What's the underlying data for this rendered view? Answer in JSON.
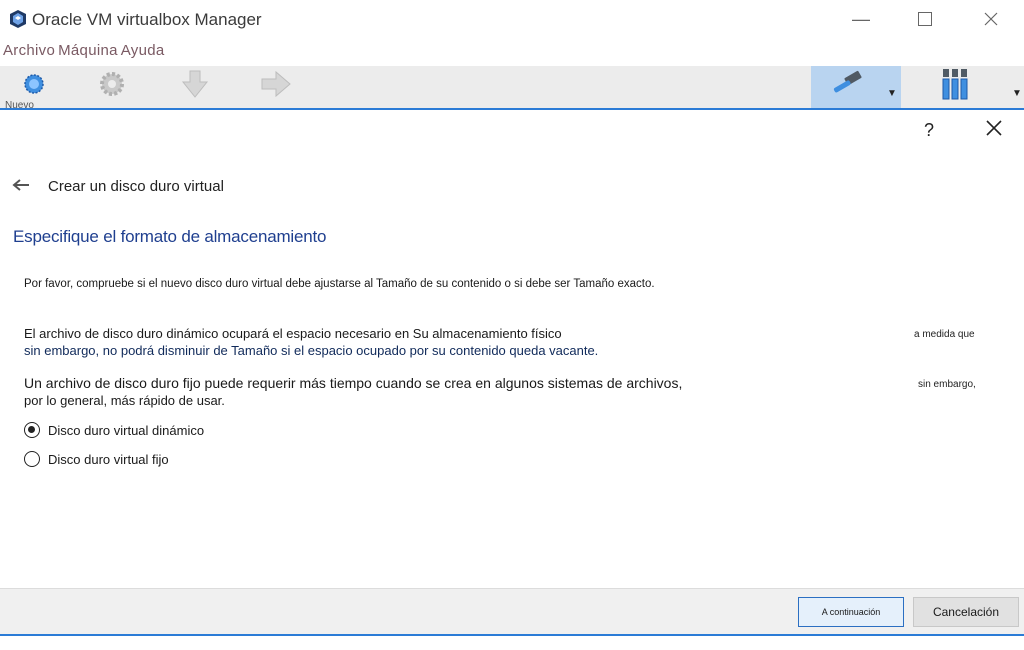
{
  "window": {
    "title": "Oracle VM virtualbox Manager"
  },
  "menu": {
    "items": [
      "Archivo",
      "Máquina",
      "Ayuda"
    ]
  },
  "toolbar": {
    "new_label": "Nuevo",
    "tools": [
      "new-icon",
      "settings-icon",
      "discard-icon",
      "start-icon",
      "machine-tools-icon",
      "global-tools-icon"
    ]
  },
  "dialog": {
    "help": "?",
    "title": "Crear un disco duro virtual",
    "section": "Especifique el formato de almacenamiento",
    "p1": "Por favor, compruebe si el nuevo disco duro virtual debe ajustarse al Tamaño de su contenido o si debe ser Tamaño exacto.",
    "p2_line1": "El archivo de disco duro dinámico ocupará el espacio necesario en Su almacenamiento físico",
    "p2_note": "a medida que",
    "p2_line2": "sin embargo, no podrá disminuir de Tamaño si el espacio ocupado por su contenido queda vacante.",
    "p3_line1": "Un archivo de disco duro fijo puede requerir más tiempo cuando se crea en algunos sistemas de archivos,",
    "p3_note": "sin embargo,",
    "p3_line2": "por lo general, más rápido de usar.",
    "options": [
      {
        "label": "Disco duro virtual dinámico",
        "checked": true
      },
      {
        "label": "Disco duro virtual fijo",
        "checked": false
      }
    ],
    "next_label": "A continuación",
    "cancel_label": "Cancelación"
  },
  "colors": {
    "accent": "#2b7bd6",
    "section_title": "#1f3f8f",
    "menu_text": "#7a5a63"
  }
}
